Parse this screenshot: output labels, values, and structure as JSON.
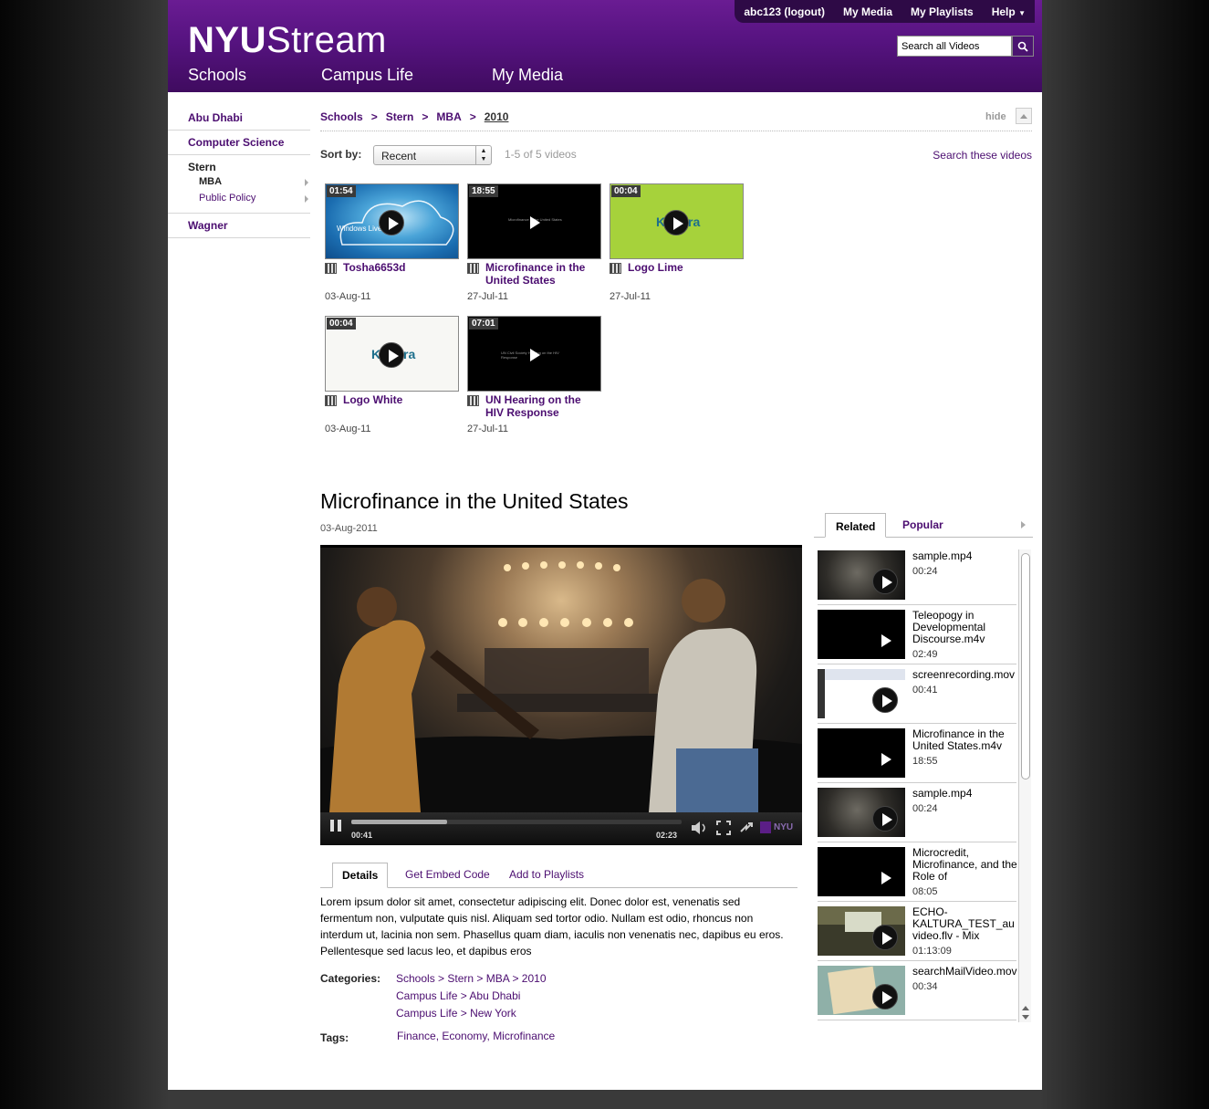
{
  "header": {
    "logo_bold": "NYU",
    "logo_rest": "Stream",
    "top_links": [
      "abc123 (logout)",
      "My Media",
      "My Playlists",
      "Help"
    ],
    "nav": [
      "Schools",
      "Campus Life",
      "My Media"
    ],
    "search_placeholder": "Search all Videos"
  },
  "sidebar": {
    "items": [
      {
        "label": "Abu Dhabi"
      },
      {
        "label": "Computer Science"
      },
      {
        "label": "Stern",
        "children": [
          "MBA",
          "Public Policy"
        ]
      },
      {
        "label": "Wagner"
      }
    ]
  },
  "breadcrumb": [
    "Schools",
    "Stern",
    "MBA",
    "2010"
  ],
  "breadcrumb_sep": ">",
  "hide_label": "hide",
  "sort": {
    "label": "Sort by:",
    "value": "Recent",
    "count": "1-5 of 5 videos",
    "search_these": "Search these videos"
  },
  "videos": [
    {
      "duration": "01:54",
      "title": "Tosha6653d",
      "date": "03-Aug-11"
    },
    {
      "duration": "18:55",
      "title": "Microfinance in the United States",
      "date": "27-Jul-11"
    },
    {
      "duration": "00:04",
      "title": "Logo  Lime",
      "date": "27-Jul-11"
    },
    {
      "duration": "00:04",
      "title": "Logo  White",
      "date": "03-Aug-11"
    },
    {
      "duration": "07:01",
      "title": "UN Hearing on the HIV Response",
      "date": "27-Jul-11"
    }
  ],
  "thumb_text": {
    "v1": "Windows Live",
    "v2": "Microfinance in the United States",
    "v3": "Kaltura",
    "v4": "Kaltura",
    "v5": "UN Civil Society Hearing on the HIV Response"
  },
  "main": {
    "title": "Microfinance in the United States",
    "date": "03-Aug-2011",
    "player": {
      "current": "00:41",
      "total": "02:23",
      "progress": 0.29,
      "brand": "NYU"
    },
    "tabs": [
      "Details",
      "Get Embed Code",
      "Add to Playlists"
    ],
    "description": "Lorem ipsum dolor sit amet, consectetur adipiscing elit. Donec dolor est, venenatis sed fermentum non, vulputate quis nisl. Aliquam sed tortor odio. Nullam est odio, rhoncus non interdum ut, lacinia non sem. Phasellus quam diam, iaculis non venenatis nec, dapibus eu eros. Pellentesque sed lacus leo, et dapibus eros",
    "categories_label": "Categories:",
    "categories": [
      [
        "Schools",
        "Stern",
        "MBA",
        "2010"
      ],
      [
        "Campus Life",
        "Abu Dhabi"
      ],
      [
        "Campus Life",
        "New York"
      ]
    ],
    "tags_label": "Tags:",
    "tags": [
      "Finance",
      "Economy",
      "Microfinance"
    ]
  },
  "related": {
    "tabs": [
      "Related",
      "Popular"
    ],
    "items": [
      {
        "title": "sample.mp4",
        "duration": "00:24"
      },
      {
        "title": "Teleopogy in Developmental Discourse.m4v",
        "duration": "02:49"
      },
      {
        "title": "screenrecording.mov",
        "duration": "00:41"
      },
      {
        "title": "Microfinance in the United States.m4v",
        "duration": "18:55"
      },
      {
        "title": "sample.mp4",
        "duration": "00:24"
      },
      {
        "title": "Microcredit, Microfinance, and the Role of",
        "duration": "08:05"
      },
      {
        "title": "ECHO-KALTURA_TEST_au video.flv - Mix",
        "duration": "01:13:09"
      },
      {
        "title": "searchMailVideo.mov",
        "duration": "00:34"
      }
    ]
  },
  "colors": {
    "brand_purple": "#561380",
    "link": "#4b0d70",
    "lime": "#a6d23b"
  }
}
